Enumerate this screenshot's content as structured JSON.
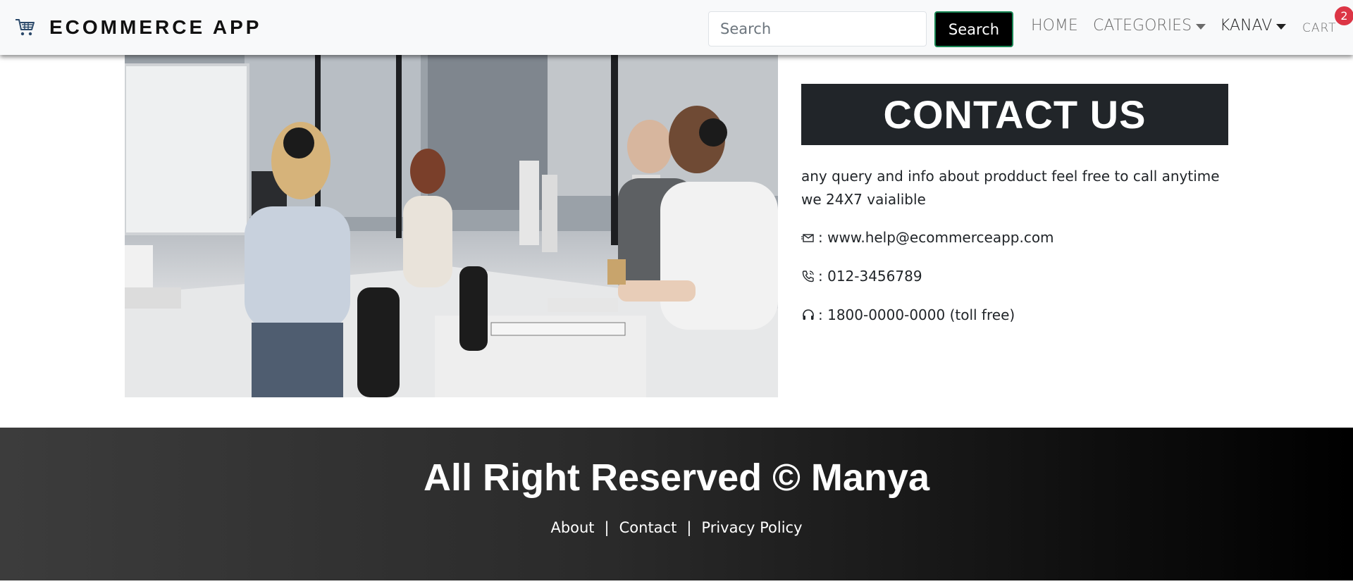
{
  "navbar": {
    "brand": "ECOMMERCE APP",
    "brand_icon": "shopping-cart-icon",
    "search_placeholder": "Search",
    "search_button": "Search",
    "home": "HOME",
    "categories": "CATEGORIES",
    "user": "KANAV",
    "cart": "CART",
    "cart_count": "2"
  },
  "contact": {
    "title": "CONTACT US",
    "description": "any query and info about prodduct feel free to call anytime we 24X7 vaialible",
    "email": ": www.help@ecommerceapp.com",
    "phone": ": 012-3456789",
    "support": ": 1800-0000-0000 (toll free)",
    "icons": [
      "mail-icon",
      "phone-icon",
      "headset-icon"
    ]
  },
  "footer": {
    "title": "All Right Reserved © Manya",
    "links": [
      "About",
      "Contact",
      "Privacy Policy"
    ],
    "separator": "|"
  },
  "colors": {
    "navbar_bg": "#f8f9fa",
    "title_box_bg": "#212529",
    "search_button_border": "#198754",
    "cart_badge": "#dc3545",
    "footer_gradient_start": "#3c3c3c",
    "footer_gradient_end": "#000000"
  }
}
